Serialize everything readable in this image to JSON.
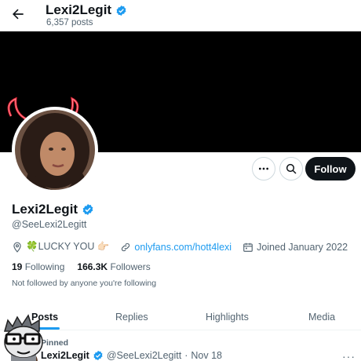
{
  "header": {
    "title": "Lexi2Legit",
    "post_count": "6,357 posts"
  },
  "profile": {
    "name": "Lexi2Legit",
    "handle": "@SeeLexi2Legitt",
    "bio_text": "🍀LUCKY YOU 👉🏻",
    "link_text": "onlyfans.com/hott4lexi",
    "joined": "Joined January 2022",
    "following_count": "19",
    "following_label": "Following",
    "followers_count": "166.3K",
    "followers_label": "Followers",
    "not_followed": "Not followed by anyone you're following"
  },
  "actions": {
    "follow_label": "Follow"
  },
  "tabs": [
    {
      "label": "Posts"
    },
    {
      "label": "Replies"
    },
    {
      "label": "Highlights"
    },
    {
      "label": "Media"
    }
  ],
  "post": {
    "pinned_label": "Pinned",
    "name": "Lexi2Legit",
    "handle": "@SeeLexi2Legitt",
    "separator": "·",
    "date": "Nov 18",
    "more": "···"
  },
  "colors": {
    "accent": "#1d9bf0",
    "text": "#0f1419",
    "muted": "#536471",
    "banner": "#000000",
    "verified": "#1d9bf0"
  },
  "icons": {
    "back": "arrow-left-icon",
    "verified": "verified-badge-icon",
    "more": "more-horizontal-icon",
    "search": "search-icon",
    "location": "location-pin-icon",
    "link": "link-icon",
    "calendar": "calendar-icon"
  }
}
